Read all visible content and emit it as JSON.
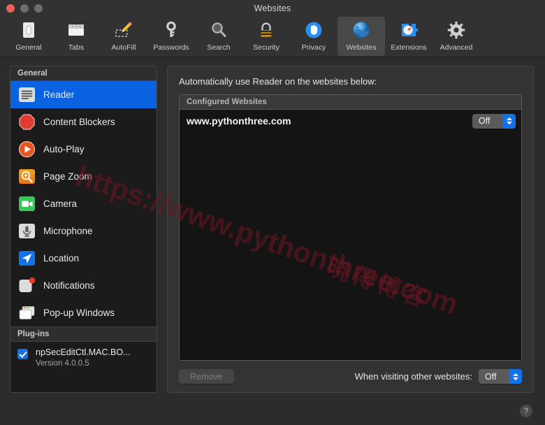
{
  "window": {
    "title": "Websites",
    "traffic_lights": [
      "close-button",
      "minimize-button",
      "maximize-button"
    ]
  },
  "toolbar": {
    "items": [
      {
        "label": "General",
        "icon": "general-icon",
        "selected": false
      },
      {
        "label": "Tabs",
        "icon": "tabs-icon",
        "selected": false
      },
      {
        "label": "AutoFill",
        "icon": "autofill-icon",
        "selected": false
      },
      {
        "label": "Passwords",
        "icon": "passwords-icon",
        "selected": false
      },
      {
        "label": "Search",
        "icon": "search-icon",
        "selected": false
      },
      {
        "label": "Security",
        "icon": "security-icon",
        "selected": false
      },
      {
        "label": "Privacy",
        "icon": "privacy-icon",
        "selected": false
      },
      {
        "label": "Websites",
        "icon": "websites-icon",
        "selected": true
      },
      {
        "label": "Extensions",
        "icon": "extensions-icon",
        "selected": false
      },
      {
        "label": "Advanced",
        "icon": "advanced-icon",
        "selected": false
      }
    ]
  },
  "sidebar": {
    "general_header": "General",
    "items": [
      {
        "label": "Reader",
        "icon": "reader-icon",
        "selected": true
      },
      {
        "label": "Content Blockers",
        "icon": "content-blockers-icon",
        "selected": false
      },
      {
        "label": "Auto-Play",
        "icon": "auto-play-icon",
        "selected": false
      },
      {
        "label": "Page Zoom",
        "icon": "page-zoom-icon",
        "selected": false
      },
      {
        "label": "Camera",
        "icon": "camera-icon",
        "selected": false
      },
      {
        "label": "Microphone",
        "icon": "microphone-icon",
        "selected": false
      },
      {
        "label": "Location",
        "icon": "location-icon",
        "selected": false
      },
      {
        "label": "Notifications",
        "icon": "notifications-icon",
        "selected": false
      },
      {
        "label": "Pop-up Windows",
        "icon": "popup-windows-icon",
        "selected": false
      }
    ],
    "plugins_header": "Plug-ins",
    "plugins": [
      {
        "name": "npSecEditCtl.MAC.BO...",
        "version": "Version 4.0.0.5",
        "checked": true
      }
    ]
  },
  "main": {
    "caption": "Automatically use Reader on the websites below:",
    "list_header": "Configured Websites",
    "rows": [
      {
        "site": "www.pythonthree.com",
        "setting": "Off"
      }
    ],
    "remove_label": "Remove",
    "remove_enabled": false,
    "visiting_label": "When visiting other websites:",
    "visiting_value": "Off"
  },
  "help": {
    "glyph": "?"
  },
  "watermark": {
    "url": "https://www.pythonthree.com",
    "chinese": "晓得博客"
  },
  "colors": {
    "accent_blue": "#0a62e0",
    "popup_blue": "#1273e8",
    "window_bg": "#2c2c2c",
    "sidebar_bg": "#1b1b1b",
    "list_bg": "#141414",
    "watermark_red": "#6d1722"
  }
}
